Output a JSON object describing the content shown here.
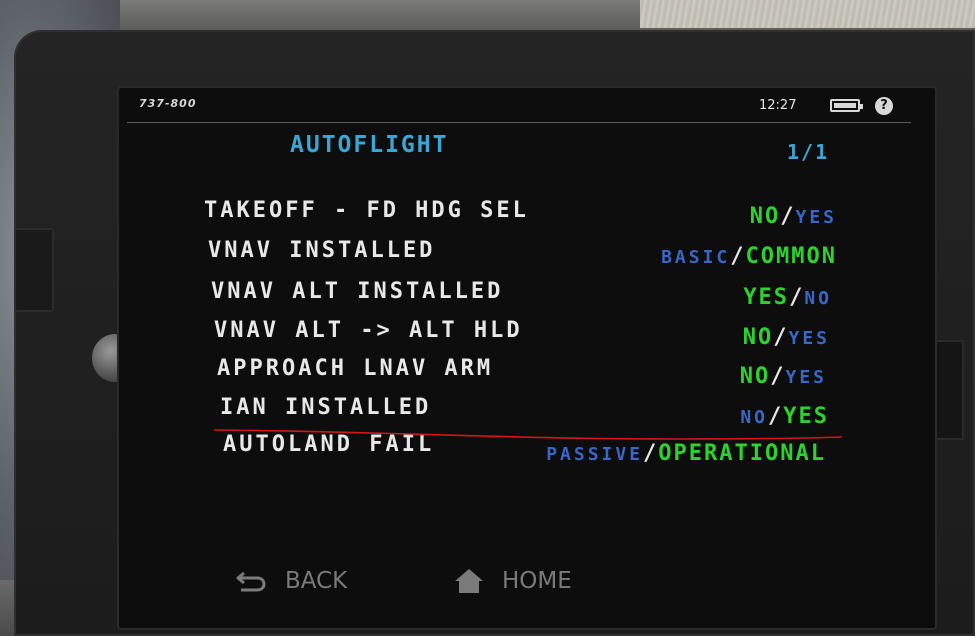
{
  "header": {
    "model": "737-800",
    "time": "12:27",
    "battery_icon": "battery-icon",
    "help_icon": "help-icon",
    "help_glyph": "?"
  },
  "page": {
    "title": "AUTOFLIGHT",
    "page_number": "1/1"
  },
  "options": [
    {
      "label": "TAKEOFF - FD HDG SEL",
      "first": "NO",
      "second": "YES",
      "selected": "first"
    },
    {
      "label": "VNAV INSTALLED",
      "first": "BASIC",
      "second": "COMMON",
      "selected": "second"
    },
    {
      "label": "VNAV ALT INSTALLED",
      "first": "YES",
      "second": "NO",
      "selected": "first"
    },
    {
      "label": "VNAV ALT -> ALT HLD",
      "first": "NO",
      "second": "YES",
      "selected": "first"
    },
    {
      "label": "APPROACH LNAV ARM",
      "first": "NO",
      "second": "YES",
      "selected": "first"
    },
    {
      "label": "IAN INSTALLED",
      "first": "NO",
      "second": "YES",
      "selected": "second"
    },
    {
      "label": "AUTOLAND FAIL",
      "first": "PASSIVE",
      "second": "OPERATIONAL",
      "selected": "second"
    }
  ],
  "separator": "/",
  "nav": {
    "back_label": "BACK",
    "home_label": "HOME"
  },
  "colors": {
    "selected": "#2fd12f",
    "unselected": "#3a66c8",
    "title": "#3aa6d6",
    "annotation_line": "#d01818"
  }
}
